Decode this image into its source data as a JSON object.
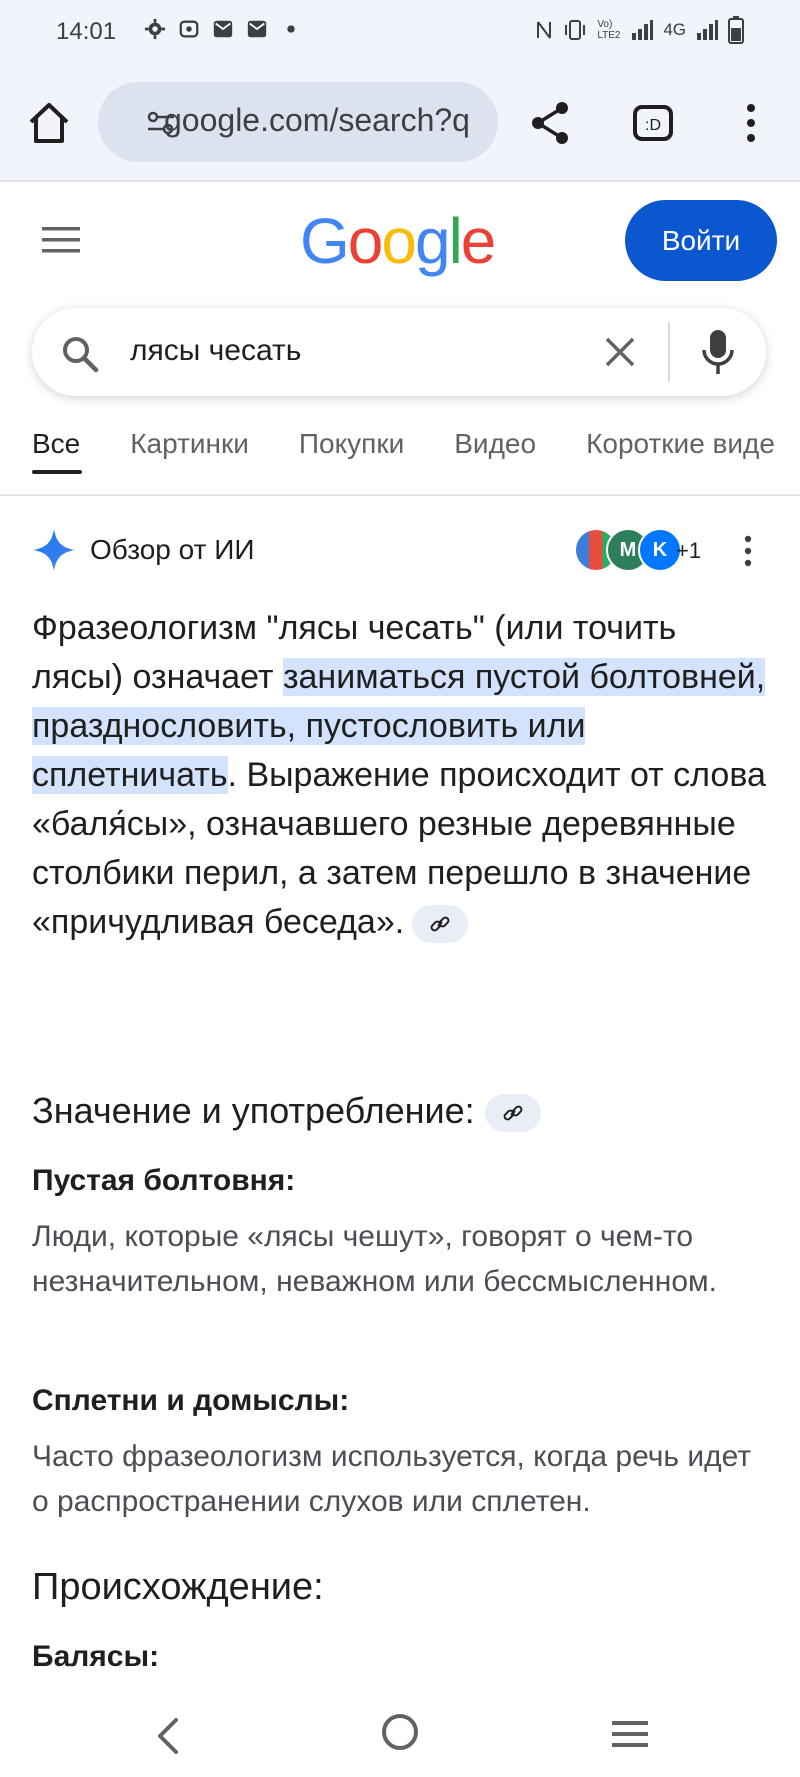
{
  "status_bar": {
    "time": "14:01",
    "network": "4G",
    "lte_label": "Vo) LTE2"
  },
  "browser": {
    "url": "google.com/search?q",
    "icons": [
      "home-icon",
      "tune-icon",
      "share-icon",
      "tabs-icon",
      "more-vert-icon"
    ]
  },
  "google": {
    "logo_letters": [
      {
        "ch": "G",
        "color": "#4285F4"
      },
      {
        "ch": "o",
        "color": "#EA4335"
      },
      {
        "ch": "o",
        "color": "#FBBC05"
      },
      {
        "ch": "g",
        "color": "#4285F4"
      },
      {
        "ch": "l",
        "color": "#34A853"
      },
      {
        "ch": "e",
        "color": "#EA4335"
      }
    ],
    "login_label": "Войти"
  },
  "search": {
    "query": "лясы чесать"
  },
  "tabs": [
    "Все",
    "Картинки",
    "Покупки",
    "Видео",
    "Короткие виде"
  ],
  "ai_overview": {
    "title": "Обзор от ИИ",
    "sources_more": "+1",
    "para_part1": "Фразеологизм \"лясы чесать\" (или точить лясы) означает ",
    "para_highlight": "заниматься пустой болтовней, празднословить, пустословить или сплетничать",
    "para_part2": ". Выражение происходит от слова «баля́сы», означавшего резные деревянные столбики перил, а затем перешло в значение «причудливая беседа».",
    "section_usage": "Значение и употребление:",
    "sub1_title": "Пустая болтовня:",
    "sub1_text": "Люди, которые «лясы чешут», говорят о чем-то незначительном, неважном или бессмысленном.",
    "sub2_title": "Сплетни и домыслы:",
    "sub2_text": "Часто фразеологизм используется, когда речь идет о распространении слухов или сплетен.",
    "section_origin": "Происхождение:",
    "sub3_title": "Балясы:"
  },
  "colors": {
    "accent": "#0b57d0",
    "highlight": "#d3e3fd",
    "toolbar_bg": "#f1f4fb"
  }
}
